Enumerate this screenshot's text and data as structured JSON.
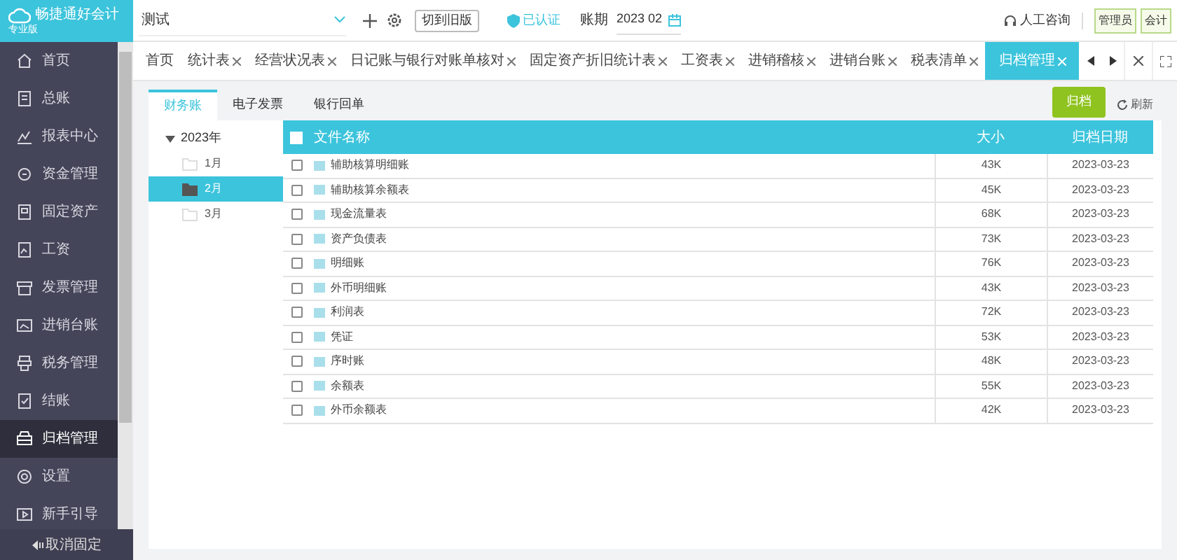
{
  "logo": {
    "name": "畅捷通好会计",
    "edition": "专业版"
  },
  "top_bar": {
    "account_select": "测试",
    "switch_button": "切到旧版",
    "verified": "已认证",
    "period_label": "账期",
    "period": "2023 02",
    "support": "人工咨询",
    "roles": [
      "管理员",
      "会计"
    ]
  },
  "sidebar": {
    "items": [
      {
        "label": "首页",
        "selected": false
      },
      {
        "label": "总账",
        "selected": false
      },
      {
        "label": "报表中心",
        "selected": false
      },
      {
        "label": "资金管理",
        "selected": false
      },
      {
        "label": "固定资产",
        "selected": false
      },
      {
        "label": "工资",
        "selected": false
      },
      {
        "label": "发票管理",
        "selected": false
      },
      {
        "label": "进销台账",
        "selected": false
      },
      {
        "label": "税务管理",
        "selected": false
      },
      {
        "label": "结账",
        "selected": false
      },
      {
        "label": "归档管理",
        "selected": true
      },
      {
        "label": "设置",
        "selected": false
      },
      {
        "label": "新手引导",
        "selected": false
      }
    ],
    "unpin": "取消固定"
  },
  "tabs": [
    {
      "label": "首页",
      "closable": false,
      "selected": false
    },
    {
      "label": "统计表",
      "closable": true,
      "selected": false
    },
    {
      "label": "经营状况表",
      "closable": true,
      "selected": false
    },
    {
      "label": "日记账与银行对账单核对",
      "closable": true,
      "selected": false
    },
    {
      "label": "固定资产折旧统计表",
      "closable": true,
      "selected": false
    },
    {
      "label": "工资表",
      "closable": true,
      "selected": false
    },
    {
      "label": "进销稽核",
      "closable": true,
      "selected": false
    },
    {
      "label": "进销台账",
      "closable": true,
      "selected": false
    },
    {
      "label": "税表清单",
      "closable": true,
      "selected": false
    },
    {
      "label": "归档管理",
      "closable": true,
      "selected": true
    }
  ],
  "archive_tabs": [
    {
      "label": "财务账",
      "selected": true
    },
    {
      "label": "电子发票",
      "selected": false
    },
    {
      "label": "银行回单",
      "selected": false
    }
  ],
  "tree": {
    "label": "2023年",
    "expanded": true,
    "children": [
      {
        "label": "1月",
        "selected": false
      },
      {
        "label": "2月",
        "selected": true
      },
      {
        "label": "3月",
        "selected": false
      }
    ]
  },
  "actions": {
    "archive": "归档",
    "refresh": "刷新"
  },
  "table": {
    "all_checked": false,
    "columns": [
      "文件名称",
      "大小",
      "归档日期"
    ],
    "rows": [
      {
        "name": "辅助核算明细账",
        "size": "43K",
        "date": "2023-03-23",
        "checked": false
      },
      {
        "name": "辅助核算余额表",
        "size": "45K",
        "date": "2023-03-23",
        "checked": false
      },
      {
        "name": "现金流量表",
        "size": "68K",
        "date": "2023-03-23",
        "checked": false
      },
      {
        "name": "资产负债表",
        "size": "73K",
        "date": "2023-03-23",
        "checked": false
      },
      {
        "name": "明细账",
        "size": "76K",
        "date": "2023-03-23",
        "checked": false
      },
      {
        "name": "外币明细账",
        "size": "43K",
        "date": "2023-03-23",
        "checked": false
      },
      {
        "name": "利润表",
        "size": "72K",
        "date": "2023-03-23",
        "checked": false
      },
      {
        "name": "凭证",
        "size": "53K",
        "date": "2023-03-23",
        "checked": false
      },
      {
        "name": "序时账",
        "size": "48K",
        "date": "2023-03-23",
        "checked": false
      },
      {
        "name": "余额表",
        "size": "55K",
        "date": "2023-03-23",
        "checked": false
      },
      {
        "name": "外币余额表",
        "size": "42K",
        "date": "2023-03-23",
        "checked": false
      }
    ]
  }
}
